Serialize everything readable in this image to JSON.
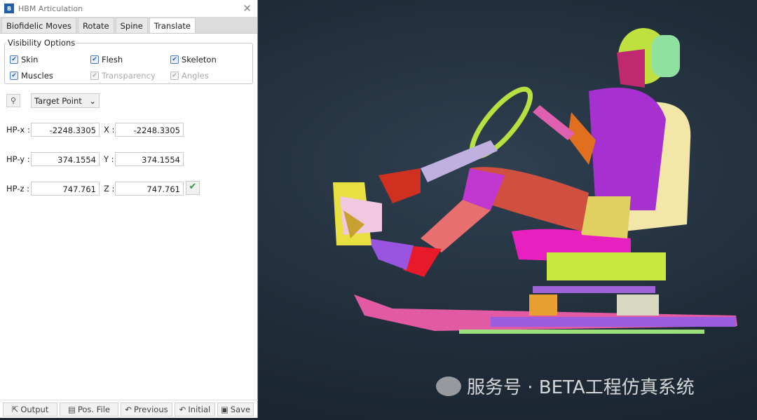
{
  "window": {
    "title": "HBM Articulation",
    "icon_text": "B"
  },
  "tabs": [
    {
      "label": "Biofidelic Moves"
    },
    {
      "label": "Rotate"
    },
    {
      "label": "Spine"
    },
    {
      "label": "Translate",
      "active": true
    }
  ],
  "visibility": {
    "title": "Visibility Options",
    "options": [
      {
        "label": "Skin",
        "checked": true,
        "enabled": true
      },
      {
        "label": "Flesh",
        "checked": true,
        "enabled": true
      },
      {
        "label": "Skeleton",
        "checked": true,
        "enabled": true
      },
      {
        "label": "Muscles",
        "checked": true,
        "enabled": true
      },
      {
        "label": "Transparency",
        "checked": true,
        "enabled": false
      },
      {
        "label": "Angles",
        "checked": true,
        "enabled": false
      }
    ]
  },
  "mode": {
    "selected": "Target Point"
  },
  "coords": [
    {
      "hp_label": "HP-x :",
      "hp_value": "-2248.3305",
      "label": "X :",
      "value": "-2248.3305"
    },
    {
      "hp_label": "HP-y :",
      "hp_value": "374.1554",
      "label": "Y :",
      "value": "374.1554"
    },
    {
      "hp_label": "HP-z :",
      "hp_value": "747.761",
      "label": "Z :",
      "value": "747.761"
    }
  ],
  "footer": {
    "output": "Output",
    "pos_file": "Pos. File",
    "previous": "Previous",
    "initial": "Initial",
    "save": "Save"
  },
  "watermark": "服务号 · BETA工程仿真系统"
}
